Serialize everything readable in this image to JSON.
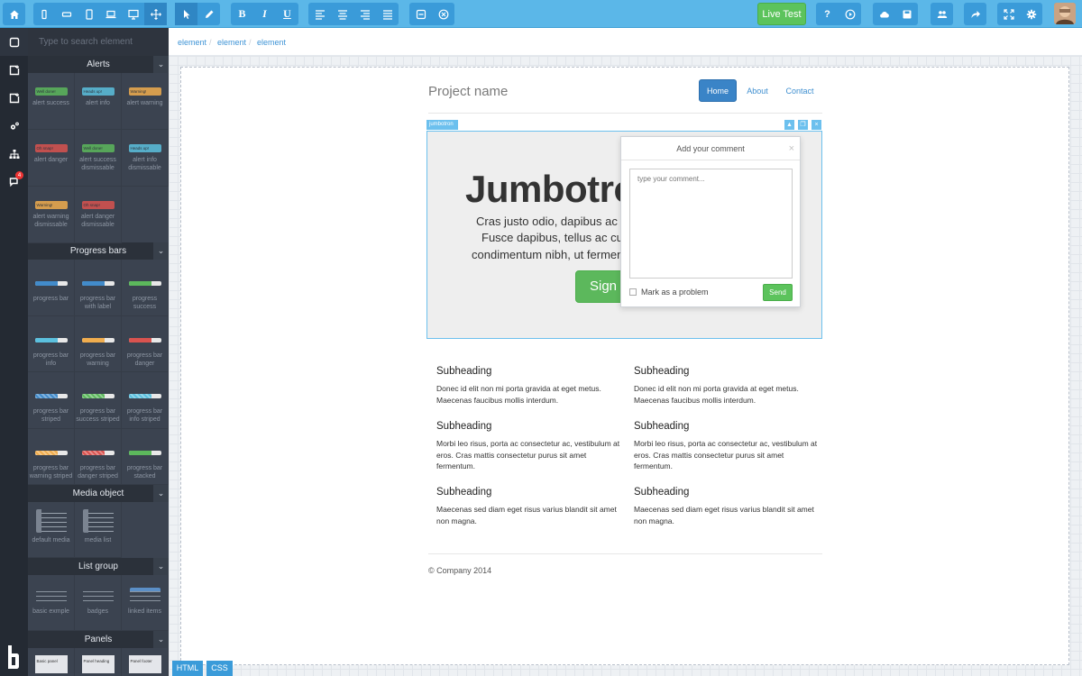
{
  "toolbar": {
    "live_test": "Live Test",
    "bold": "B",
    "italic": "I",
    "underline": "U"
  },
  "left_rail": {
    "notification_count": "4"
  },
  "panel": {
    "search_placeholder": "Type to search element",
    "sections": {
      "alerts": "Alerts",
      "progress": "Progress bars",
      "media": "Media object",
      "list": "List group",
      "panels": "Panels"
    },
    "alerts": [
      {
        "thumb": "Well done!",
        "line1": "alert success",
        "line2": "",
        "color": "#5cb85c"
      },
      {
        "thumb": "Heads up!",
        "line1": "alert info",
        "line2": "",
        "color": "#5bc0de"
      },
      {
        "thumb": "Warning!",
        "line1": "alert warning",
        "line2": "",
        "color": "#f0ad4e"
      },
      {
        "thumb": "Oh snap!",
        "line1": "alert danger",
        "line2": "",
        "color": "#d9534f"
      },
      {
        "thumb": "Well done!",
        "line1": "alert success",
        "line2": "dismissable",
        "color": "#5cb85c"
      },
      {
        "thumb": "Heads up!",
        "line1": "alert info",
        "line2": "dismissable",
        "color": "#5bc0de"
      },
      {
        "thumb": "Warning!",
        "line1": "alert warning",
        "line2": "dismissable",
        "color": "#f0ad4e"
      },
      {
        "thumb": "Oh snap!",
        "line1": "alert danger",
        "line2": "dismissable",
        "color": "#d9534f"
      }
    ],
    "progress": [
      {
        "line1": "progress bar",
        "line2": "",
        "color": "#428bca"
      },
      {
        "line1": "progress bar",
        "line2": "with label",
        "color": "#428bca"
      },
      {
        "line1": "progress",
        "line2": "success",
        "color": "#5cb85c"
      },
      {
        "line1": "progress bar",
        "line2": "info",
        "color": "#5bc0de"
      },
      {
        "line1": "progress bar",
        "line2": "warning",
        "color": "#f0ad4e"
      },
      {
        "line1": "progress bar",
        "line2": "danger",
        "color": "#d9534f"
      },
      {
        "line1": "progress bar",
        "line2": "striped",
        "color": "#428bca"
      },
      {
        "line1": "progress bar",
        "line2": "success striped",
        "color": "#5cb85c"
      },
      {
        "line1": "progress bar",
        "line2": "info striped",
        "color": "#5bc0de"
      },
      {
        "line1": "progress bar",
        "line2": "warning striped",
        "color": "#f0ad4e"
      },
      {
        "line1": "progress bar",
        "line2": "danger striped",
        "color": "#d9534f"
      },
      {
        "line1": "progress bar",
        "line2": "stacked",
        "color": "#5cb85c"
      }
    ],
    "media": [
      {
        "line1": "default media"
      },
      {
        "line1": "media list"
      }
    ],
    "list": [
      {
        "line1": "basic exmple"
      },
      {
        "line1": "badges"
      },
      {
        "line1": "linked items"
      }
    ],
    "panels": [
      {
        "thumb": "Basic panel"
      },
      {
        "thumb": "Panel heading"
      },
      {
        "thumb": "Panel footer"
      }
    ]
  },
  "breadcrumb": [
    "element",
    "element",
    "element"
  ],
  "site": {
    "brand": "Project name",
    "nav": [
      "Home",
      "About",
      "Contact"
    ],
    "jumbotron_tag": "jumbotron",
    "jumbotron_title": "Jumbotron",
    "jumbotron_lines": [
      "Cras justo odio, dapibus ac f",
      "Fusce dapibus, tellus ac cu",
      "condimentum nibh, ut fermen"
    ],
    "signup": "Sign up",
    "columns": [
      {
        "heading": "Subheading",
        "text": "Donec id elit non mi porta gravida at eget metus. Maecenas faucibus mollis interdum."
      },
      {
        "heading": "Subheading",
        "text": "Donec id elit non mi porta gravida at eget metus. Maecenas faucibus mollis interdum."
      },
      {
        "heading": "Subheading",
        "text": "Morbi leo risus, porta ac consectetur ac, vestibulum at eros. Cras mattis consectetur purus sit amet fermentum."
      },
      {
        "heading": "Subheading",
        "text": "Morbi leo risus, porta ac consectetur ac, vestibulum at eros. Cras mattis consectetur purus sit amet fermentum."
      },
      {
        "heading": "Subheading",
        "text": "Maecenas sed diam eget risus varius blandit sit amet non magna."
      },
      {
        "heading": "Subheading",
        "text": "Maecenas sed diam eget risus varius blandit sit amet non magna."
      }
    ],
    "footer": "© Company 2014"
  },
  "comment": {
    "title": "Add your comment",
    "close": "×",
    "placeholder": "type your comment...",
    "checkbox_label": "Mark as a problem",
    "send": "Send"
  },
  "bottom_tabs": [
    "HTML",
    "CSS"
  ]
}
